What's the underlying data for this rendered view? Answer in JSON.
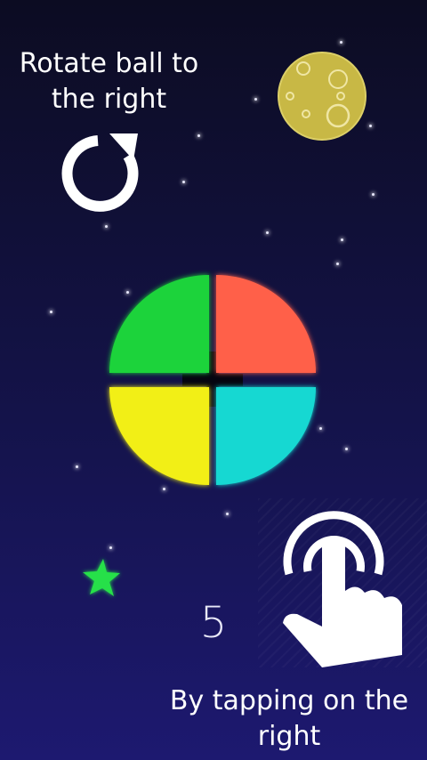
{
  "instructions": {
    "top_line1": "Rotate ball to",
    "top_line2": "the right",
    "bottom_line1": "By tapping on the",
    "bottom_line2": "right"
  },
  "score": "5",
  "ball": {
    "quadrants": [
      {
        "name": "top-left",
        "color": "#1ed33a"
      },
      {
        "name": "top-right",
        "color": "#ff614a"
      },
      {
        "name": "bottom-left",
        "color": "#f2ef12"
      },
      {
        "name": "bottom-right",
        "color": "#14d8d2"
      }
    ]
  },
  "icons": {
    "rotate": "rotate-right-icon",
    "tap": "tap-hand-icon",
    "moon": "moon-icon",
    "star": "star-icon"
  },
  "colors": {
    "moon": "#c8b845",
    "star": "#27e04a",
    "text": "#ffffff"
  }
}
